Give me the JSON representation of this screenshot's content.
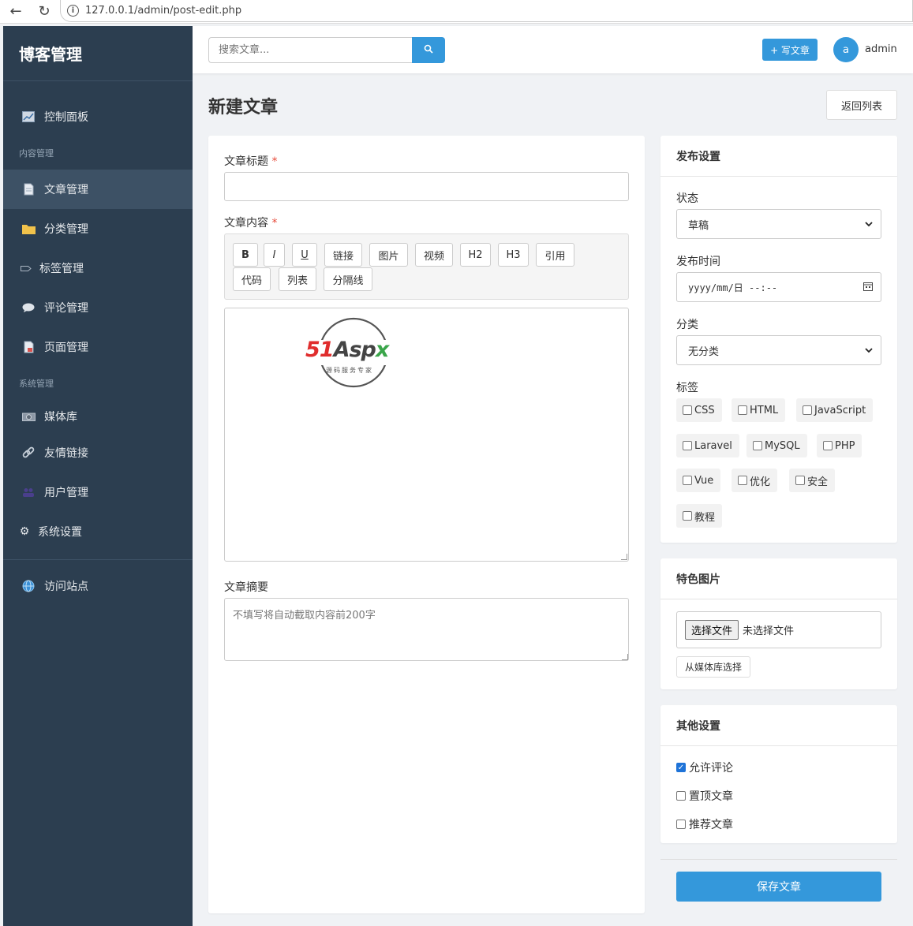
{
  "browser": {
    "url": "127.0.0.1/admin/post-edit.php"
  },
  "sidebar": {
    "brand": "博客管理",
    "dashboard": "控制面板",
    "section_content": "内容管理",
    "section_system": "系统管理",
    "items": [
      {
        "label": "文章管理",
        "icon": "document-icon"
      },
      {
        "label": "分类管理",
        "icon": "folder-icon"
      },
      {
        "label": "标签管理",
        "icon": "tag-icon"
      },
      {
        "label": "评论管理",
        "icon": "comment-icon"
      },
      {
        "label": "页面管理",
        "icon": "page-icon"
      }
    ],
    "system_items": [
      {
        "label": "媒体库",
        "icon": "camera-icon"
      },
      {
        "label": "友情链接",
        "icon": "link-icon"
      },
      {
        "label": "用户管理",
        "icon": "users-icon"
      },
      {
        "label": "系统设置",
        "icon": "gear-icon"
      }
    ],
    "visit_site": "访问站点"
  },
  "topbar": {
    "search_placeholder": "搜索文章...",
    "write_button": "+ 写文章",
    "avatar_letter": "a",
    "username": "admin"
  },
  "page": {
    "title": "新建文章",
    "back_button": "返回列表"
  },
  "form": {
    "title_label": "文章标题",
    "content_label": "文章内容",
    "required_mark": "*",
    "toolbar": [
      "B",
      "I",
      "U",
      "链接",
      "图片",
      "视频",
      "H2",
      "H3",
      "引用",
      "代码",
      "列表",
      "分隔线"
    ],
    "summary_label": "文章摘要",
    "summary_placeholder": "不填写将自动截取内容前200字"
  },
  "watermark": {
    "text": "51Aspx",
    "subtext": "源码服务专家"
  },
  "publish": {
    "heading": "发布设置",
    "status_label": "状态",
    "status_value": "草稿",
    "time_label": "发布时间",
    "time_placeholder": "yyyy/mm/日 --:--",
    "category_label": "分类",
    "category_value": "无分类",
    "tags_label": "标签",
    "tags": [
      "CSS",
      "HTML",
      "JavaScript",
      "Laravel",
      "MySQL",
      "PHP",
      "Vue",
      "优化",
      "安全",
      "教程"
    ]
  },
  "featured": {
    "heading": "特色图片",
    "choose_file": "选择文件",
    "no_file": "未选择文件",
    "media_button": "从媒体库选择"
  },
  "other": {
    "heading": "其他设置",
    "options": [
      {
        "label": "允许评论",
        "checked": true
      },
      {
        "label": "置顶文章",
        "checked": false
      },
      {
        "label": "推荐文章",
        "checked": false
      }
    ]
  },
  "save_button": "保存文章"
}
